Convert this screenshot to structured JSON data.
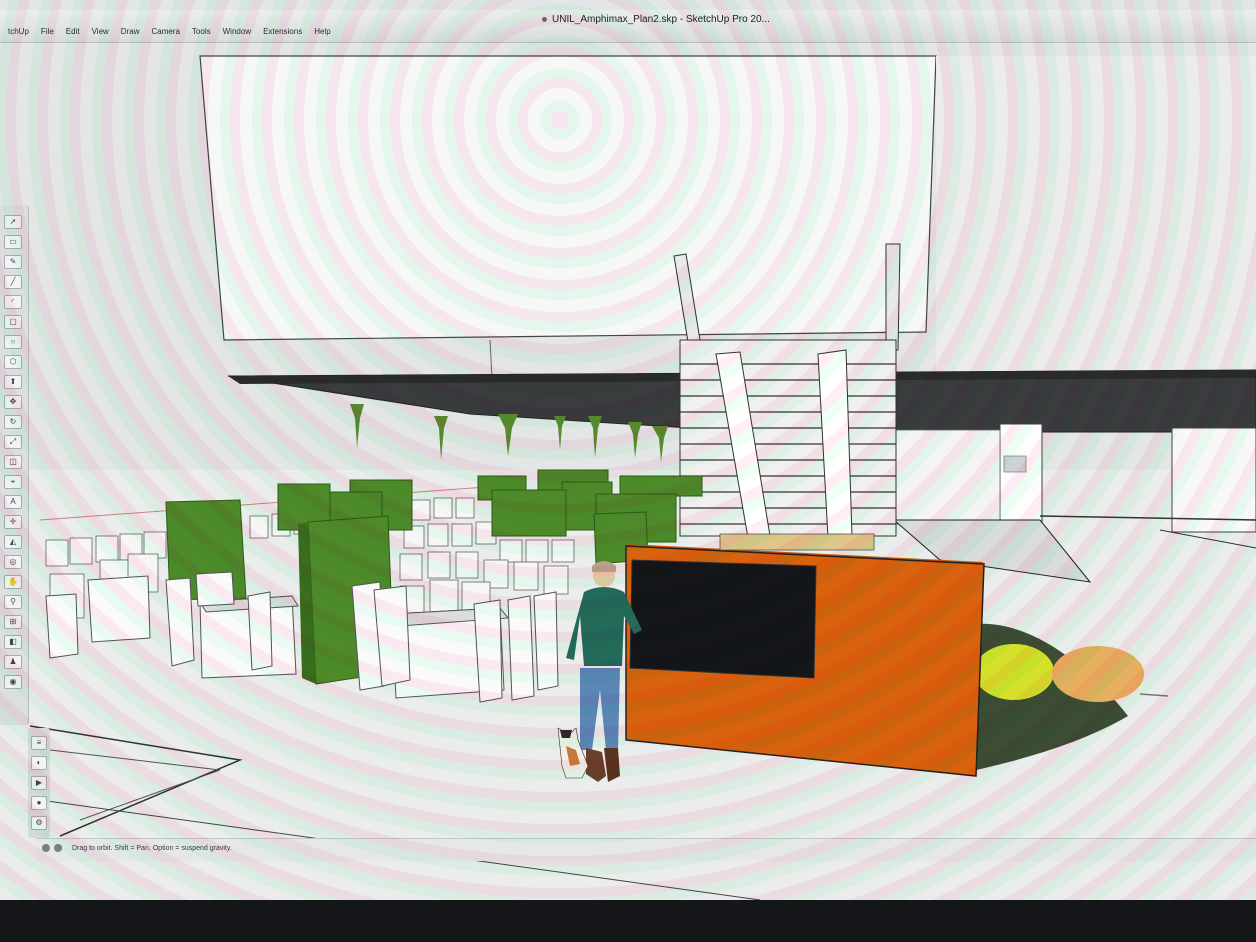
{
  "window": {
    "title": "UNIL_Amphimax_Plan2.skp - SketchUp Pro 20..."
  },
  "menu": {
    "app_name": "tchUp",
    "items": [
      "File",
      "Edit",
      "View",
      "Draw",
      "Camera",
      "Tools",
      "Window",
      "Extensions",
      "Help"
    ]
  },
  "status": {
    "hint": "Drag to orbit. Shift = Pan, Option = suspend gravity."
  },
  "colors": {
    "background": "#e3e6e6",
    "hedge": "#4f8a2a",
    "kiosk": "#d9620e",
    "screen": "#14161a",
    "pouf_yellow": "#d4e02a",
    "pouf_orange": "#e7b060",
    "green_rug": "#3d4d34"
  },
  "icons": {
    "title_dot": "document-dot-icon",
    "toolbar": [
      "select-icon",
      "eraser-icon",
      "pencil-icon",
      "line-icon",
      "arc-icon",
      "rectangle-icon",
      "circle-icon",
      "polygon-icon",
      "push-pull-icon",
      "move-icon",
      "rotate-icon",
      "scale-icon",
      "offset-icon",
      "tape-measure-icon",
      "text-icon",
      "axes-icon",
      "paint-bucket-icon",
      "orbit-icon",
      "pan-icon",
      "zoom-icon",
      "zoom-extents-icon",
      "section-plane-icon",
      "walk-icon",
      "look-around-icon"
    ]
  }
}
